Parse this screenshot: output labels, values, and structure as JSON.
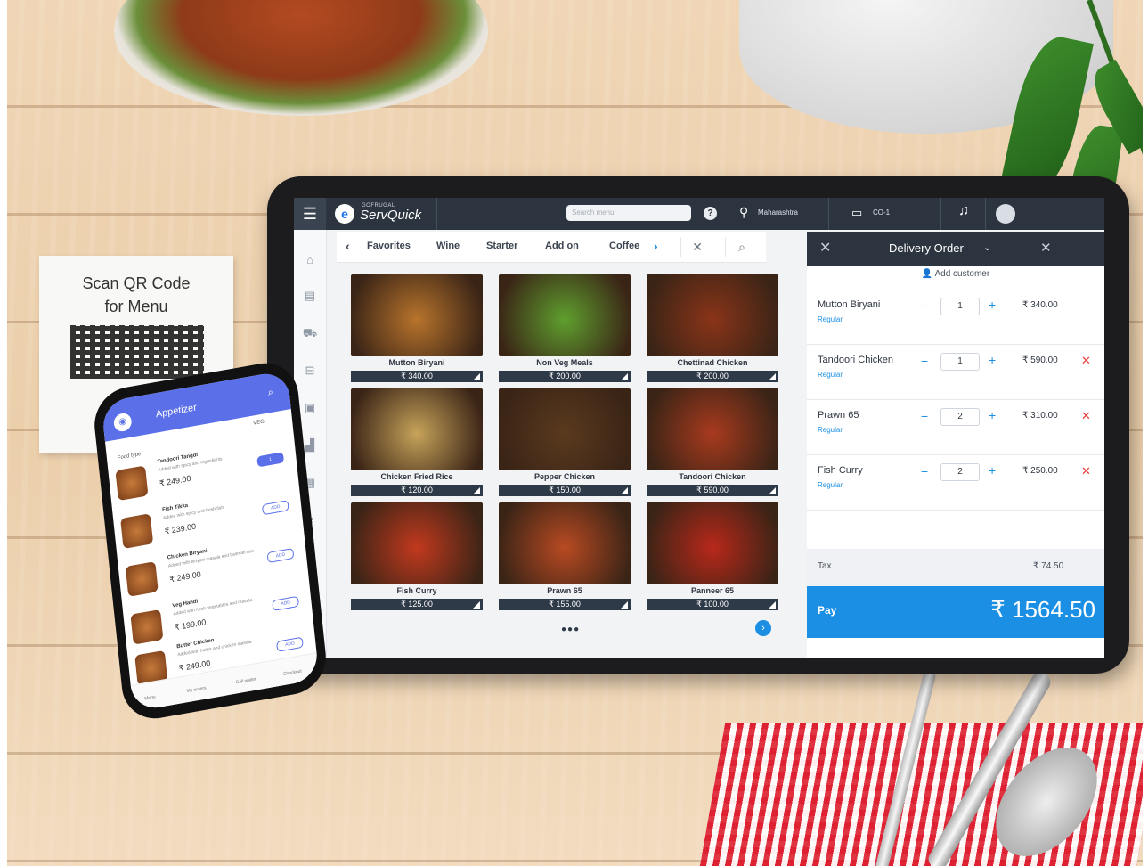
{
  "qr_card": {
    "title_line1": "Scan QR Code",
    "title_line2": "for Menu"
  },
  "tablet": {
    "brand_small": "GOFRUGAL",
    "brand": "ServQuick",
    "search_placeholder": "Search menu",
    "help_icon": "?",
    "location": "Maharashtra",
    "terminal": "CO-1",
    "categories": [
      "Favorites",
      "Wine",
      "Starter",
      "Add on",
      "Coffee"
    ],
    "menu_items": [
      {
        "name": "Mutton Biryani",
        "price": "₹ 340.00",
        "color": "#b8742c"
      },
      {
        "name": "Non Veg Meals",
        "price": "₹ 200.00",
        "color": "#5f9f2e"
      },
      {
        "name": "Chettinad Chicken",
        "price": "₹ 200.00",
        "color": "#8a3418"
      },
      {
        "name": "Chicken Fried Rice",
        "price": "₹ 120.00",
        "color": "#c7a35a"
      },
      {
        "name": "Pepper Chicken",
        "price": "₹ 150.00",
        "color": "#5a3a1e"
      },
      {
        "name": "Tandoori Chicken",
        "price": "₹ 590.00",
        "color": "#a83a1e"
      },
      {
        "name": "Fish Curry",
        "price": "₹ 125.00",
        "color": "#c2391e"
      },
      {
        "name": "Prawn 65",
        "price": "₹ 155.00",
        "color": "#b84a22"
      },
      {
        "name": "Panneer 65",
        "price": "₹ 100.00",
        "color": "#b8281a"
      }
    ],
    "order": {
      "title": "Delivery Order",
      "add_customer": "Add customer",
      "items": [
        {
          "name": "Mutton Biryani",
          "variant": "Regular",
          "qty": "1",
          "price": "₹ 340.00"
        },
        {
          "name": "Tandoori Chicken",
          "variant": "Regular",
          "qty": "1",
          "price": "₹ 590.00"
        },
        {
          "name": "Prawn 65",
          "variant": "Regular",
          "qty": "2",
          "price": "₹ 310.00"
        },
        {
          "name": "Fish Curry",
          "variant": "Regular",
          "qty": "2",
          "price": "₹ 250.00"
        }
      ],
      "tax_label": "Tax",
      "tax_value": "₹ 74.50",
      "pay_label": "Pay",
      "total": "₹ 1564.50"
    }
  },
  "phone": {
    "title": "Appetizer",
    "veg_label": "VEG",
    "food_type_label": "Food type",
    "items": [
      {
        "name": "Tandoori Tangdi",
        "desc": "Added with spicy and ingredients",
        "price": "₹ 249.00",
        "action": "1"
      },
      {
        "name": "Fish Tikka",
        "desc": "Added with spicy and fresh fish",
        "price": "₹ 239.00",
        "action": "ADD"
      },
      {
        "name": "Chicken Biryani",
        "desc": "Added with biriyani masala and basmati rice",
        "price": "₹ 249.00",
        "action": "ADD"
      },
      {
        "name": "Veg Handi",
        "desc": "Added with fresh vegetables and masala",
        "price": "₹ 199.00",
        "action": "ADD"
      },
      {
        "name": "Butter Chicken",
        "desc": "Added with butter and chicken masala",
        "price": "₹ 249.00",
        "action": "ADD"
      }
    ],
    "nav": [
      "Menu",
      "My orders",
      "Call waiter",
      "Checkout"
    ]
  }
}
